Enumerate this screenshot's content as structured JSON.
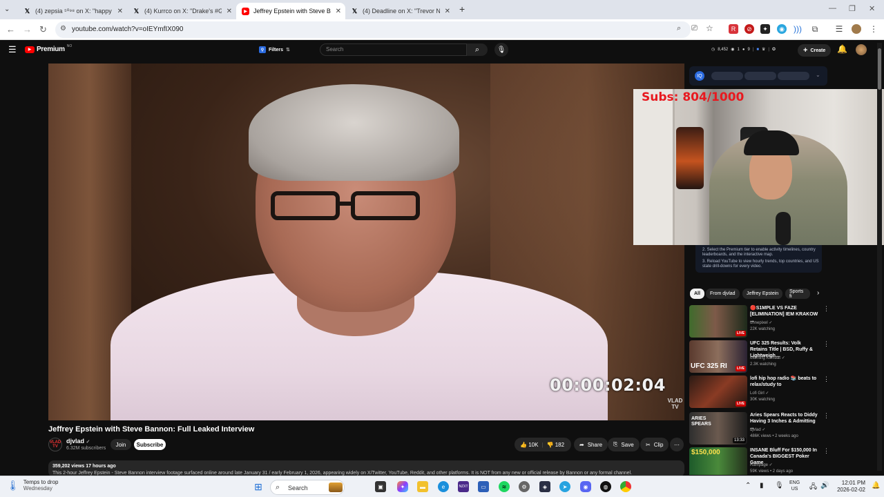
{
  "browser": {
    "tabs": [
      {
        "title": "(4) zepsia ⁵⁰⁹⁸ on X: \"happy bi...",
        "favicon": "X",
        "active": false
      },
      {
        "title": "(4) Kurrco on X: \"Drake's #GRA...",
        "favicon": "X",
        "active": false
      },
      {
        "title": "Jeffrey Epstein with Steve Bann...",
        "favicon": "youtube",
        "active": true
      },
      {
        "title": "(4) Deadline on X: \"Trevor Noah...",
        "favicon": "X",
        "active": false
      }
    ],
    "new_tab": "+",
    "url": "youtube.com/watch?v=oIEYmfIX090"
  },
  "youtube": {
    "logo": "Premium",
    "logo_badge": "NO",
    "filters_label": "Filters",
    "search_placeholder": "Search",
    "stats": {
      "count1": "8,452",
      "count2": "1",
      "count3": "9"
    },
    "create_label": "Create"
  },
  "video": {
    "timecode": "00:00:02:04",
    "watermark": "VLAD TV",
    "title": "Jeffrey Epstein with Steve Bannon: Full Leaked Interview",
    "channel": "djvlad",
    "channel_avatar": "VLAD TV",
    "subscribers": "6.32M subscribers",
    "join_label": "Join",
    "subscribe_label": "Subscribe",
    "likes": "10K",
    "dislikes": "182",
    "share_label": "Share",
    "save_label": "Save",
    "clip_label": "Clip",
    "views_line": "359,202 views  17 hours ago",
    "description": "This 2-hour Jeffrey Epstein - Steve Bannon interview footage surfaced online around late January 31 / early February 1, 2026, appearing widely on X/Twitter, YouTube, Reddit, and other platforms. It is NOT from any new or official release by Bannon or any formal channel."
  },
  "overlay": {
    "subs_text": "Subs: 804/1000"
  },
  "extension_panel": {
    "line1": "2.  Select the Premium tier to enable activity timelines, country leaderboards, and the interactive map.",
    "line2": "3.  Reload YouTube to view hourly trends, top countries, and US state drill-downs for every video."
  },
  "chips": [
    "All",
    "From djvlad",
    "Jeffrey Epstein",
    "Sports fi"
  ],
  "recommendations": [
    {
      "title": "🔴S1MPLE VS FAZE [ELIMINATION] IEM KRAKOW ...",
      "channel": "ohnepixel ✓",
      "meta": "22K watching",
      "badge": "LIVE"
    },
    {
      "title": "UFC 325 Results: Volk Retains Title | BSD, Ruffy & Lightweigh...",
      "channel": "Morning Kombat ✓",
      "meta": "2.3K watching",
      "badge": "LIVE"
    },
    {
      "title": "lofi hip hop radio 📚 beats to relax/study to",
      "channel": "Lofi Girl ✓",
      "meta": "30K watching",
      "badge": "LIVE"
    },
    {
      "title": "Aries Spears Reacts to Diddy Having 3 Inches & Admitting ...",
      "channel": "djvlad ✓",
      "meta": "486K views • 2 weeks ago",
      "badge": "13:33"
    },
    {
      "title": "INSANE Bluff For $150,000 In Canada's BIGGEST Poker Game",
      "channel": "Rampage ✓",
      "meta": "59K views • 2 days ago",
      "badge": ""
    }
  ],
  "thumb_text": {
    "t2": "UFC 325 RI",
    "t4": "ARIES SPEARS",
    "t5": "$150,000"
  },
  "taskbar": {
    "weather_temp": "Temps to drop",
    "weather_day": "Wednesday",
    "search_label": "Search",
    "lang": "ENG",
    "region": "US",
    "time": "12:01 PM",
    "date": "2026-02-02"
  },
  "colors": {
    "youtube_red": "#ff0000",
    "live_red": "#cc0000",
    "overlay_red": "#e8191f"
  }
}
